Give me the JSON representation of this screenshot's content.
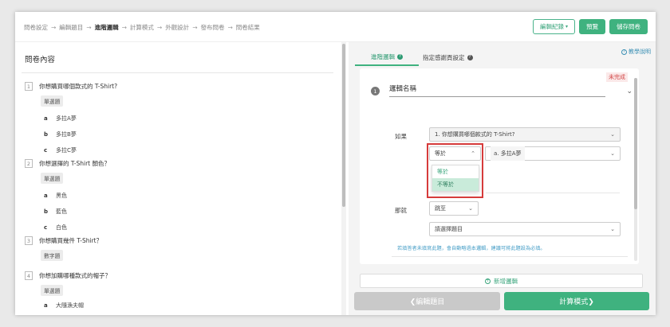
{
  "breadcrumb": [
    "問卷設定",
    "編輯題目",
    "進階邏輯",
    "計算模式",
    "外觀設計",
    "發布問卷",
    "問卷結果"
  ],
  "breadcrumb_arrow": "→",
  "top_actions": {
    "history": "編輯紀錄",
    "preview": "預覽",
    "save": "儲存問卷"
  },
  "left": {
    "title": "問卷內容",
    "questions": [
      {
        "num": "1",
        "text": "你想購買哪個款式的 T-Shirt?",
        "type": "單選題",
        "options": [
          {
            "key": "a",
            "label": "多拉A夢"
          },
          {
            "key": "b",
            "label": "多拉B夢"
          },
          {
            "key": "c",
            "label": "多拉C夢"
          }
        ]
      },
      {
        "num": "2",
        "text": "你想選擇的 T-Shirt 顏色？",
        "type": "單選題",
        "options": [
          {
            "key": "a",
            "label": "黑色"
          },
          {
            "key": "b",
            "label": "藍色"
          },
          {
            "key": "c",
            "label": "白色"
          }
        ]
      },
      {
        "num": "3",
        "text": "你想購買幾件 T-Shirt？",
        "type": "數字題",
        "options": []
      },
      {
        "num": "4",
        "text": "你想加購哪種款式的帽子？",
        "type": "單選題",
        "options": [
          {
            "key": "a",
            "label": "大隨漁夫帽"
          }
        ]
      }
    ]
  },
  "right": {
    "tabs": [
      "進階邏輯",
      "指定感謝頁設定"
    ],
    "help": "教學說明",
    "status": "未完成",
    "logic_num": "1",
    "logic_name": "邏輯名稱",
    "if_label": "如果",
    "if_question": "1. 你想購買哪個款式的 T-Shirt?",
    "operator": "等於",
    "answer": "a. 多拉A夢",
    "operator_options": [
      "等於",
      "不等於"
    ],
    "then_label": "那就",
    "action": "跳至",
    "target_placeholder": "請選擇題目",
    "hint": "若填答者未填寫此題，會自動略過本邏輯，建議可將此題設為必填。",
    "add_logic": "新增邏輯",
    "prev": "❮編輯題目",
    "next": "計算模式❯"
  },
  "colors": {
    "accent": "#3fb27f",
    "warning": "#d63b3b"
  }
}
